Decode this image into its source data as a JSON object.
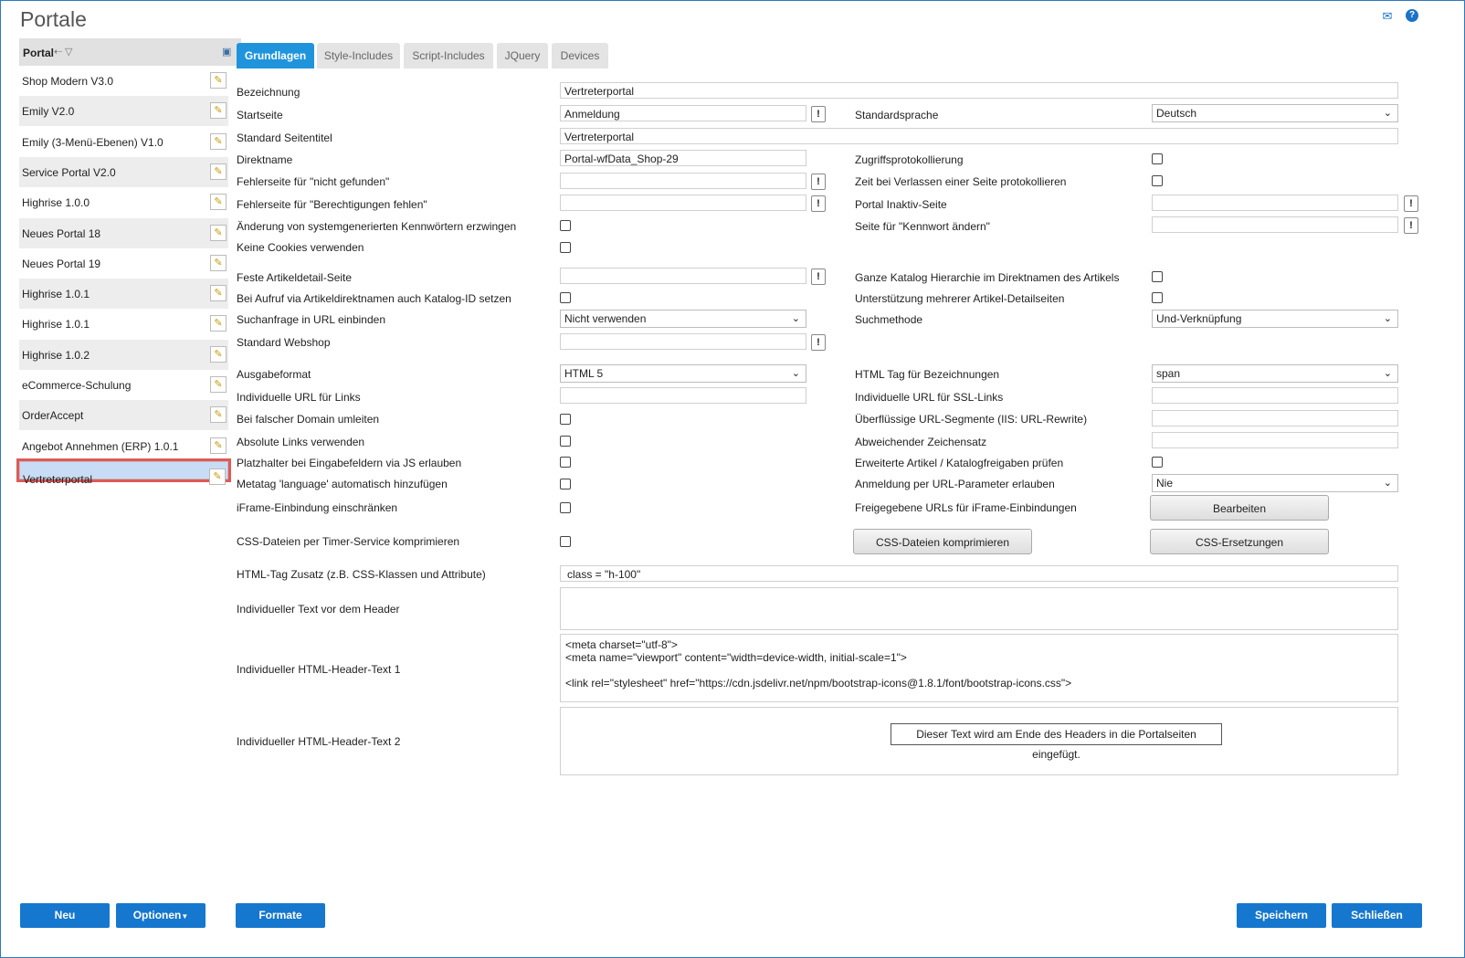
{
  "title": "Portale",
  "sidebar": {
    "header": "Portal",
    "items": [
      "Shop Modern V3.0",
      "Emily V2.0",
      "Emily (3-Menü-Ebenen) V1.0",
      "Service Portal V2.0",
      "Highrise 1.0.0",
      "Neues Portal 18",
      "Neues Portal 19",
      "Highrise 1.0.1",
      "Highrise 1.0.1",
      "Highrise 1.0.2",
      "eCommerce-Schulung",
      "OrderAccept",
      "Angebot Annehmen (ERP) 1.0.1",
      "Vertreterportal"
    ],
    "selected_index": 13
  },
  "tabs": [
    "Grundlagen",
    "Style-Includes",
    "Script-Includes",
    "JQuery",
    "Devices"
  ],
  "form": {
    "bezeichnung": {
      "label": "Bezeichnung",
      "value": "Vertreterportal"
    },
    "startseite": {
      "label": "Startseite",
      "value": "Anmeldung"
    },
    "standardsprache": {
      "label": "Standardsprache",
      "value": "Deutsch"
    },
    "seitentitel": {
      "label": "Standard Seitentitel",
      "value": "Vertreterportal"
    },
    "direktname": {
      "label": "Direktname",
      "value": "Portal-wfData_Shop-29"
    },
    "zugriffsprotokollierung": {
      "label": "Zugriffsprotokollierung"
    },
    "fehler_nicht_gefunden": {
      "label": "Fehlerseite für \"nicht gefunden\""
    },
    "zeit_verlassen": {
      "label": "Zeit bei Verlassen einer Seite protokollieren"
    },
    "fehler_berechtigungen": {
      "label": "Fehlerseite für \"Berechtigungen fehlen\""
    },
    "inaktiv_seite": {
      "label": "Portal Inaktiv-Seite"
    },
    "kennwort_erzwingen": {
      "label": "Änderung von systemgenerierten Kennwörtern erzwingen"
    },
    "kennwort_aendern": {
      "label": "Seite für \"Kennwort ändern\""
    },
    "keine_cookies": {
      "label": "Keine Cookies verwenden"
    },
    "artikeldetail": {
      "label": "Feste Artikeldetail-Seite"
    },
    "katalog_hierarchie": {
      "label": "Ganze Katalog Hierarchie im Direktnamen des Artikels"
    },
    "katalog_id": {
      "label": "Bei Aufruf via Artikeldirektnamen auch Katalog-ID setzen"
    },
    "mehrere_detailseiten": {
      "label": "Unterstützung mehrerer Artikel-Detailseiten"
    },
    "suchanfrage": {
      "label": "Suchanfrage in URL einbinden",
      "value": "Nicht verwenden"
    },
    "suchmethode": {
      "label": "Suchmethode",
      "value": "Und-Verknüpfung"
    },
    "webshop": {
      "label": "Standard Webshop"
    },
    "ausgabeformat": {
      "label": "Ausgabeformat",
      "value": "HTML 5"
    },
    "html_tag": {
      "label": "HTML Tag für Bezeichnungen",
      "value": "span"
    },
    "url_links": {
      "label": "Individuelle URL für Links"
    },
    "url_ssl": {
      "label": "Individuelle URL für SSL-Links"
    },
    "falsche_domain": {
      "label": "Bei falscher Domain umleiten"
    },
    "url_segmente": {
      "label": "Überflüssige URL-Segmente (IIS: URL-Rewrite)"
    },
    "absolute_links": {
      "label": "Absolute Links verwenden"
    },
    "zeichensatz": {
      "label": "Abweichender Zeichensatz"
    },
    "platzhalter": {
      "label": "Platzhalter bei Eingabefeldern via JS erlauben"
    },
    "katalogfreigaben": {
      "label": "Erweiterte Artikel / Katalogfreigaben prüfen"
    },
    "metatag_language": {
      "label": "Metatag 'language' automatisch hinzufügen"
    },
    "url_parameter": {
      "label": "Anmeldung per URL-Parameter erlauben",
      "value": "Nie"
    },
    "iframe": {
      "label": "iFrame-Einbindung einschränken"
    },
    "iframe_urls": {
      "label": "Freigegebene URLs für iFrame-Einbindungen"
    },
    "bearbeiten_button": "Bearbeiten",
    "css_timer": {
      "label": "CSS-Dateien per Timer-Service komprimieren"
    },
    "css_komprimieren_button": "CSS-Dateien komprimieren",
    "css_ersetzungen_button": "CSS-Ersetzungen",
    "html_tag_zusatz": {
      "label": "HTML-Tag Zusatz (z.B. CSS-Klassen und Attribute)",
      "value": "class = \"h-100\""
    },
    "text_vor_header": {
      "label": "Individueller Text vor dem Header"
    },
    "header_text_1": {
      "label": "Individueller HTML-Header-Text 1",
      "lines": [
        "<meta charset=\"utf-8\">",
        "<meta name=\"viewport\" content=\"width=device-width, initial-scale=1\">",
        "",
        "<link rel=\"stylesheet\" href=\"https://cdn.jsdelivr.net/npm/bootstrap-icons@1.8.1/font/bootstrap-icons.css\">"
      ]
    },
    "header_text_2": {
      "label": "Individueller HTML-Header-Text 2"
    },
    "tooltip": "Dieser Text wird am Ende des Headers in die Portalseiten eingefügt."
  },
  "footer": {
    "neu": "Neu",
    "optionen": "Optionen",
    "formate": "Formate",
    "speichern": "Speichern",
    "schliessen": "Schließen"
  },
  "icons": {
    "mail": "mail-icon",
    "help": "help-icon",
    "edit": "pencil-icon",
    "sort": "sort-icon",
    "filter": "filter-icon",
    "column_chooser": "column-chooser-icon",
    "lookup": "exclamation-icon"
  },
  "colors": {
    "accent": "#1677cf",
    "tab_active": "#1f94dc",
    "selection": "#c9dcf5",
    "highlight": "#e05959"
  }
}
